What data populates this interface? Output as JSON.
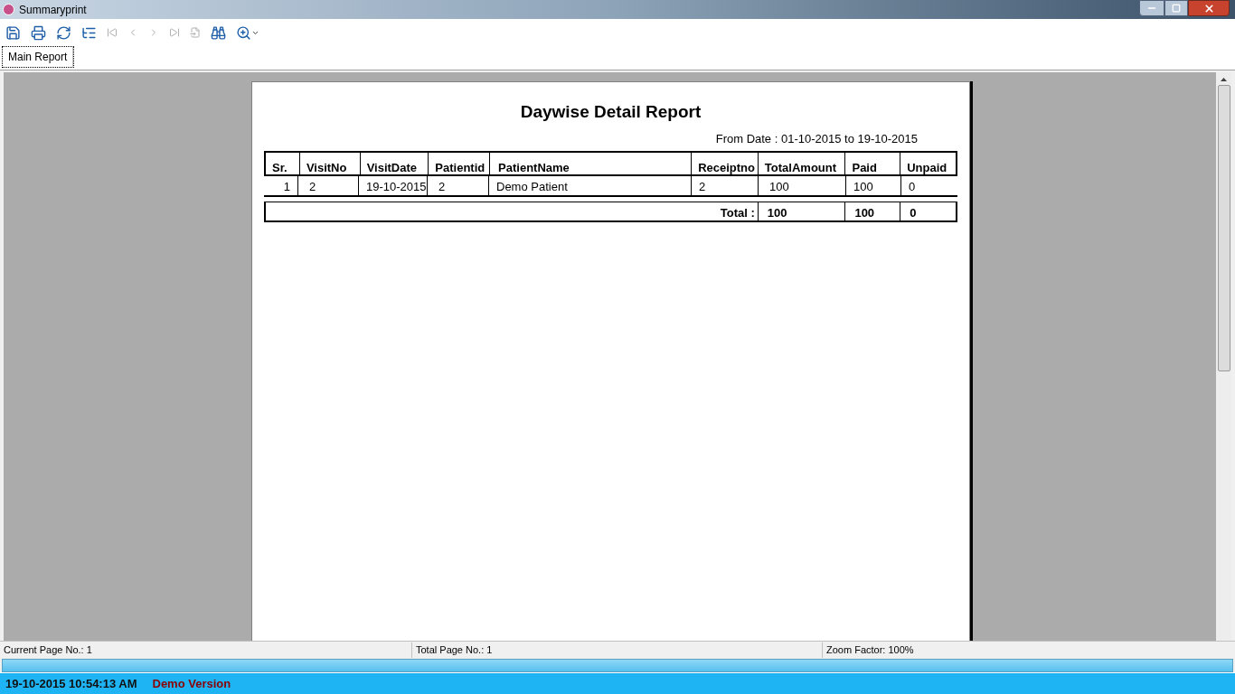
{
  "window": {
    "title": "Summaryprint"
  },
  "toolbar": [
    {
      "kind": "export",
      "disabled": false
    },
    {
      "kind": "print",
      "disabled": false
    },
    {
      "kind": "refresh",
      "disabled": false
    },
    {
      "kind": "tree",
      "disabled": false
    },
    {
      "kind": "first",
      "disabled": true
    },
    {
      "kind": "prev",
      "disabled": true
    },
    {
      "kind": "next",
      "disabled": true
    },
    {
      "kind": "last",
      "disabled": true
    },
    {
      "kind": "goto",
      "disabled": true
    },
    {
      "kind": "search",
      "disabled": false
    },
    {
      "kind": "zoom",
      "disabled": false
    }
  ],
  "tabs": [
    {
      "label": "Main Report",
      "selected": true
    }
  ],
  "report": {
    "title": "Daywise Detail Report",
    "date_range": "From Date : 01-10-2015 to 19-10-2015",
    "columns": [
      "Sr.",
      "VisitNo",
      "VisitDate",
      "Patientid",
      "PatientName",
      "Receiptno",
      "TotalAmount",
      "Paid",
      "Unpaid"
    ],
    "rows": [
      [
        "1",
        "2",
        "19-10-2015",
        "2",
        "Demo Patient",
        "2",
        "100",
        "100",
        "0"
      ]
    ],
    "total": {
      "label": "Total :",
      "values": [
        "100",
        "100",
        "0"
      ]
    }
  },
  "status_bar": [
    "Current Page No.: 1",
    "Total Page No.: 1",
    "Zoom Factor: 100%"
  ],
  "footer": {
    "datetime": "19-10-2015 10:54:13 AM",
    "edition": "Demo Version"
  }
}
